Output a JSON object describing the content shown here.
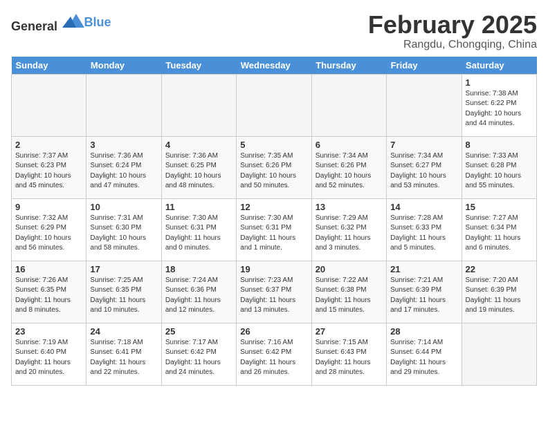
{
  "header": {
    "logo_general": "General",
    "logo_blue": "Blue",
    "month": "February 2025",
    "location": "Rangdu, Chongqing, China"
  },
  "days_of_week": [
    "Sunday",
    "Monday",
    "Tuesday",
    "Wednesday",
    "Thursday",
    "Friday",
    "Saturday"
  ],
  "weeks": [
    [
      {
        "day": "",
        "empty": true
      },
      {
        "day": "",
        "empty": true
      },
      {
        "day": "",
        "empty": true
      },
      {
        "day": "",
        "empty": true
      },
      {
        "day": "",
        "empty": true
      },
      {
        "day": "",
        "empty": true
      },
      {
        "day": "1",
        "sunrise": "7:38 AM",
        "sunset": "6:22 PM",
        "daylight": "10 hours and 44 minutes."
      }
    ],
    [
      {
        "day": "2",
        "sunrise": "7:37 AM",
        "sunset": "6:23 PM",
        "daylight": "10 hours and 45 minutes."
      },
      {
        "day": "3",
        "sunrise": "7:36 AM",
        "sunset": "6:24 PM",
        "daylight": "10 hours and 47 minutes."
      },
      {
        "day": "4",
        "sunrise": "7:36 AM",
        "sunset": "6:25 PM",
        "daylight": "10 hours and 48 minutes."
      },
      {
        "day": "5",
        "sunrise": "7:35 AM",
        "sunset": "6:26 PM",
        "daylight": "10 hours and 50 minutes."
      },
      {
        "day": "6",
        "sunrise": "7:34 AM",
        "sunset": "6:26 PM",
        "daylight": "10 hours and 52 minutes."
      },
      {
        "day": "7",
        "sunrise": "7:34 AM",
        "sunset": "6:27 PM",
        "daylight": "10 hours and 53 minutes."
      },
      {
        "day": "8",
        "sunrise": "7:33 AM",
        "sunset": "6:28 PM",
        "daylight": "10 hours and 55 minutes."
      }
    ],
    [
      {
        "day": "9",
        "sunrise": "7:32 AM",
        "sunset": "6:29 PM",
        "daylight": "10 hours and 56 minutes."
      },
      {
        "day": "10",
        "sunrise": "7:31 AM",
        "sunset": "6:30 PM",
        "daylight": "10 hours and 58 minutes."
      },
      {
        "day": "11",
        "sunrise": "7:30 AM",
        "sunset": "6:31 PM",
        "daylight": "11 hours and 0 minutes."
      },
      {
        "day": "12",
        "sunrise": "7:30 AM",
        "sunset": "6:31 PM",
        "daylight": "11 hours and 1 minute."
      },
      {
        "day": "13",
        "sunrise": "7:29 AM",
        "sunset": "6:32 PM",
        "daylight": "11 hours and 3 minutes."
      },
      {
        "day": "14",
        "sunrise": "7:28 AM",
        "sunset": "6:33 PM",
        "daylight": "11 hours and 5 minutes."
      },
      {
        "day": "15",
        "sunrise": "7:27 AM",
        "sunset": "6:34 PM",
        "daylight": "11 hours and 6 minutes."
      }
    ],
    [
      {
        "day": "16",
        "sunrise": "7:26 AM",
        "sunset": "6:35 PM",
        "daylight": "11 hours and 8 minutes."
      },
      {
        "day": "17",
        "sunrise": "7:25 AM",
        "sunset": "6:35 PM",
        "daylight": "11 hours and 10 minutes."
      },
      {
        "day": "18",
        "sunrise": "7:24 AM",
        "sunset": "6:36 PM",
        "daylight": "11 hours and 12 minutes."
      },
      {
        "day": "19",
        "sunrise": "7:23 AM",
        "sunset": "6:37 PM",
        "daylight": "11 hours and 13 minutes."
      },
      {
        "day": "20",
        "sunrise": "7:22 AM",
        "sunset": "6:38 PM",
        "daylight": "11 hours and 15 minutes."
      },
      {
        "day": "21",
        "sunrise": "7:21 AM",
        "sunset": "6:39 PM",
        "daylight": "11 hours and 17 minutes."
      },
      {
        "day": "22",
        "sunrise": "7:20 AM",
        "sunset": "6:39 PM",
        "daylight": "11 hours and 19 minutes."
      }
    ],
    [
      {
        "day": "23",
        "sunrise": "7:19 AM",
        "sunset": "6:40 PM",
        "daylight": "11 hours and 20 minutes."
      },
      {
        "day": "24",
        "sunrise": "7:18 AM",
        "sunset": "6:41 PM",
        "daylight": "11 hours and 22 minutes."
      },
      {
        "day": "25",
        "sunrise": "7:17 AM",
        "sunset": "6:42 PM",
        "daylight": "11 hours and 24 minutes."
      },
      {
        "day": "26",
        "sunrise": "7:16 AM",
        "sunset": "6:42 PM",
        "daylight": "11 hours and 26 minutes."
      },
      {
        "day": "27",
        "sunrise": "7:15 AM",
        "sunset": "6:43 PM",
        "daylight": "11 hours and 28 minutes."
      },
      {
        "day": "28",
        "sunrise": "7:14 AM",
        "sunset": "6:44 PM",
        "daylight": "11 hours and 29 minutes."
      },
      {
        "day": "",
        "empty": true
      }
    ]
  ]
}
